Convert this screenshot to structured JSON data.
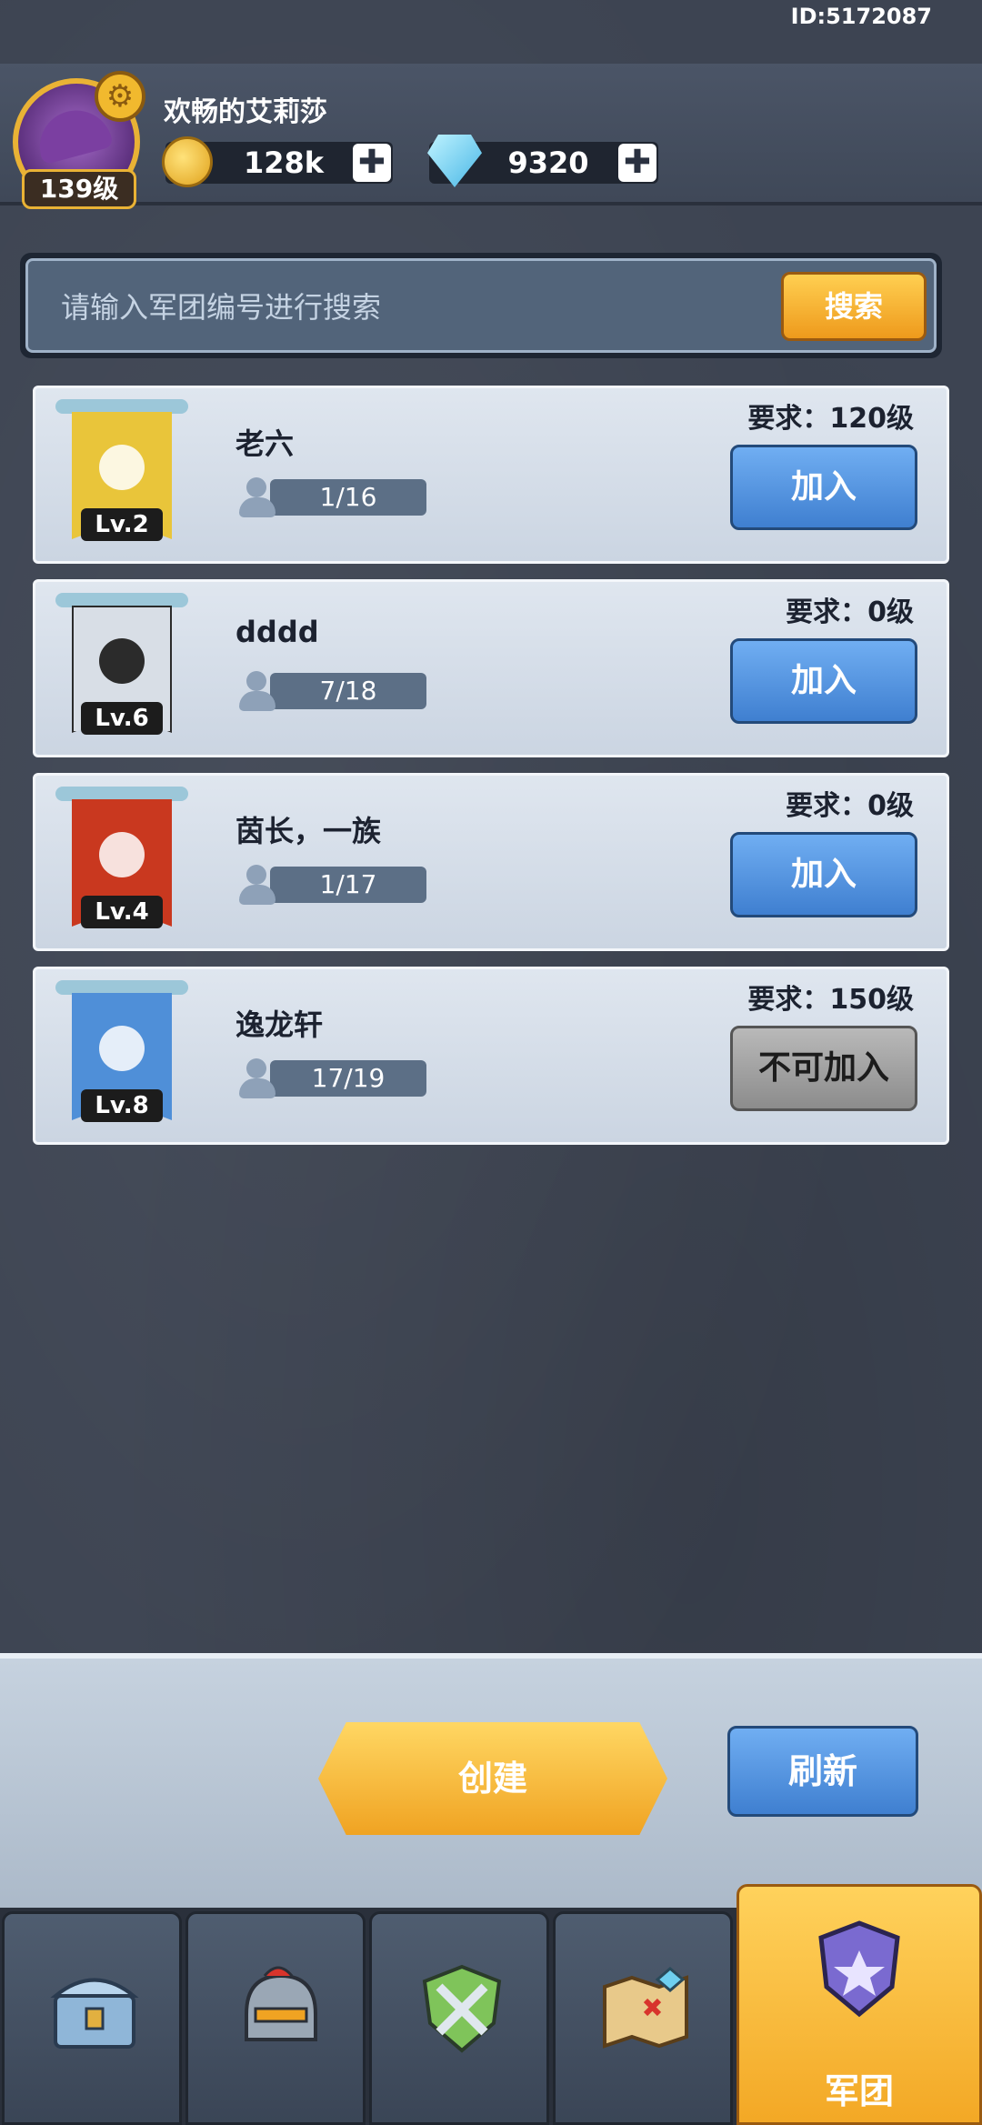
{
  "header": {
    "user_id": "ID:5172087",
    "username": "欢畅的艾莉莎",
    "level": "139级",
    "coins": "128k",
    "gems": "9320",
    "plus": "✚"
  },
  "search": {
    "placeholder": "请输入军团编号进行搜索",
    "button": "搜索"
  },
  "guilds": [
    {
      "name": "老六",
      "level": "Lv.2",
      "members": "1/16",
      "requirement": "要求：120级",
      "action": "加入",
      "color": "#e9c53a"
    },
    {
      "name": "dddd",
      "level": "Lv.6",
      "members": "7/18",
      "requirement": "要求：0级",
      "action": "加入",
      "color": "#d8dee6"
    },
    {
      "name": "茵长，一族",
      "level": "Lv.4",
      "members": "1/17",
      "requirement": "要求：0级",
      "action": "加入",
      "color": "#c9381f"
    },
    {
      "name": "逸龙轩",
      "level": "Lv.8",
      "members": "17/19",
      "requirement": "要求：150级",
      "action": "不可加入",
      "color": "#4f8fd8"
    }
  ],
  "actions": {
    "create": "创建",
    "refresh": "刷新"
  },
  "tabs": [
    {
      "icon": "chest-icon"
    },
    {
      "icon": "helmet-icon"
    },
    {
      "icon": "crossed-swords-icon"
    },
    {
      "icon": "map-icon"
    },
    {
      "icon": "guild-shield-icon",
      "label": "军团",
      "active": true
    }
  ]
}
